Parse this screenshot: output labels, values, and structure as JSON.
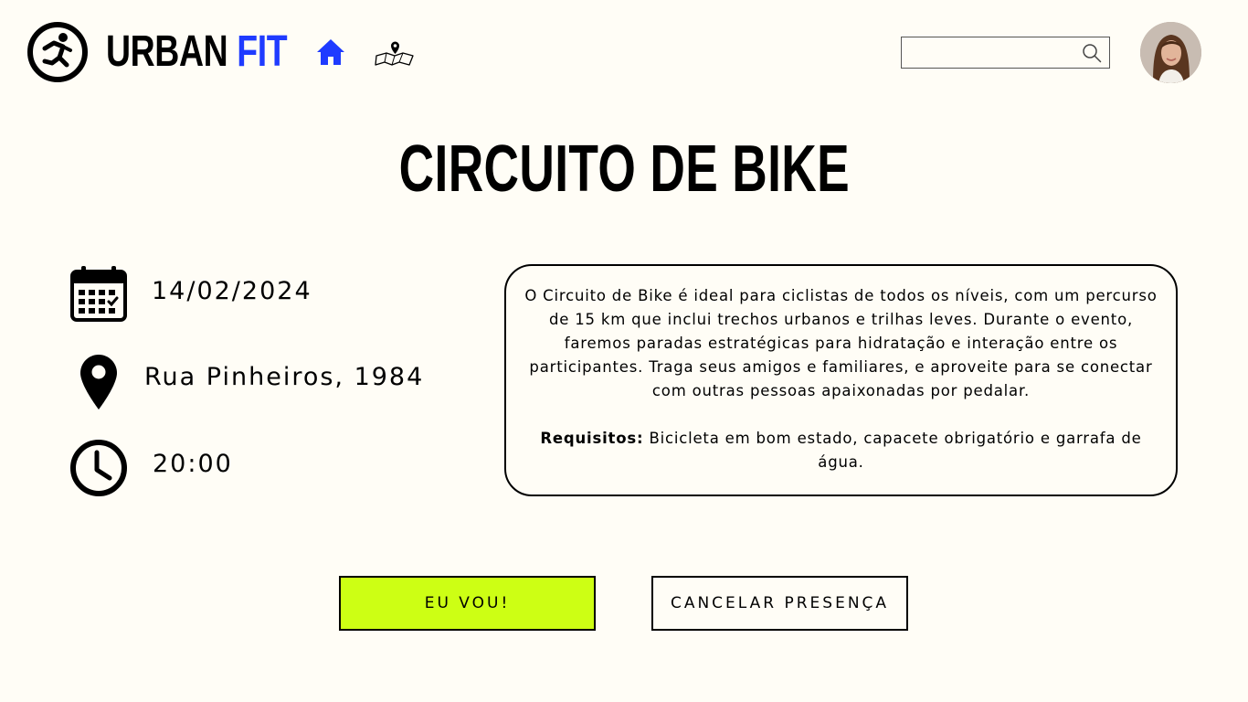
{
  "header": {
    "brand_primary": "URBAN",
    "brand_accent": "FIT",
    "accent_color": "#1f3bff",
    "nav": [
      {
        "icon": "home-icon",
        "active": true
      },
      {
        "icon": "map-icon",
        "active": false
      }
    ],
    "search": {
      "value": "",
      "placeholder": "",
      "icon": "search-icon"
    },
    "avatar": "user-avatar"
  },
  "event": {
    "title": "CIRCUITO DE BIKE",
    "date": "14/02/2024",
    "date_icon": "calendar-icon",
    "location": "Rua Pinheiros, 1984",
    "location_icon": "location-pin-icon",
    "time": "20:00",
    "time_icon": "clock-icon",
    "description": "O Circuito de Bike é ideal para ciclistas de todos os níveis, com um percurso de 15 km que inclui trechos urbanos e trilhas leves. Durante o evento, faremos paradas estratégicas para hidratação e interação entre os participantes. Traga seus amigos e familiares, e aproveite para se conectar com outras pessoas apaixonadas por pedalar.",
    "requirements_label": "Requisitos:",
    "requirements_text": "Bicicleta em bom estado, capacete obrigatório e garrafa de água."
  },
  "actions": {
    "attend_label": "EU VOU!",
    "attend_color": "#cdff14",
    "cancel_label": "CANCELAR PRESENÇA"
  }
}
